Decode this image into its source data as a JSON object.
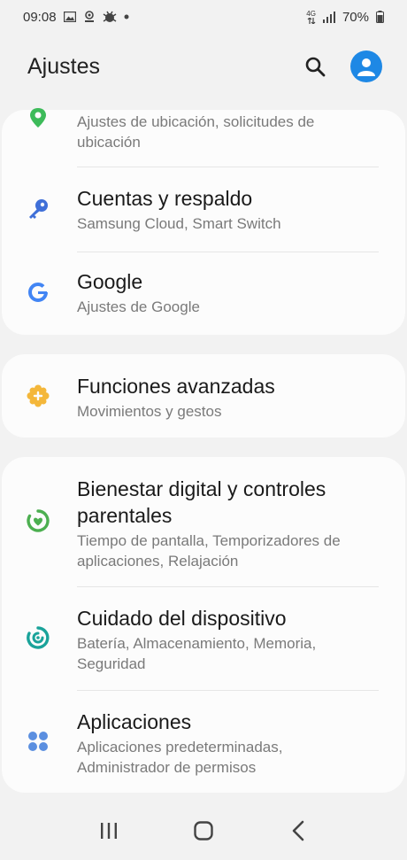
{
  "status_bar": {
    "time": "09:08",
    "network": "4G",
    "battery": "70%"
  },
  "header": {
    "title": "Ajustes",
    "search_icon": "search-icon",
    "avatar_icon": "account-icon"
  },
  "card1": {
    "items": [
      {
        "title": "",
        "subtitle": "Ajustes de ubicación, solicitudes de ubicación",
        "icon": "location-icon"
      },
      {
        "title": "Cuentas y respaldo",
        "subtitle": "Samsung Cloud, Smart Switch",
        "icon": "key-icon"
      },
      {
        "title": "Google",
        "subtitle": "Ajustes de Google",
        "icon": "google-icon"
      }
    ]
  },
  "card2": {
    "items": [
      {
        "title": "Funciones avanzadas",
        "subtitle": "Movimientos y gestos",
        "icon": "gear-plus-icon"
      }
    ]
  },
  "card3": {
    "items": [
      {
        "title": "Bienestar digital y controles parentales",
        "subtitle": "Tiempo de pantalla, Temporizadores de aplicaciones, Relajación",
        "icon": "wellbeing-icon"
      },
      {
        "title": "Cuidado del dispositivo",
        "subtitle": "Batería, Almacenamiento, Memoria, Seguridad",
        "icon": "device-care-icon"
      },
      {
        "title": "Aplicaciones",
        "subtitle": "Aplicaciones predeterminadas, Administrador de permisos",
        "icon": "apps-icon"
      }
    ]
  },
  "colors": {
    "location": "#3dbb5a",
    "key": "#3f6fd8",
    "google": "#4285f4",
    "advanced": "#f4b73a",
    "wellbeing": "#4caf50",
    "care": "#1aa39a",
    "apps": "#5b8fe0",
    "avatar": "#1e88e5"
  },
  "nav": {
    "recents": "recents-icon",
    "home": "home-icon",
    "back": "back-icon"
  }
}
